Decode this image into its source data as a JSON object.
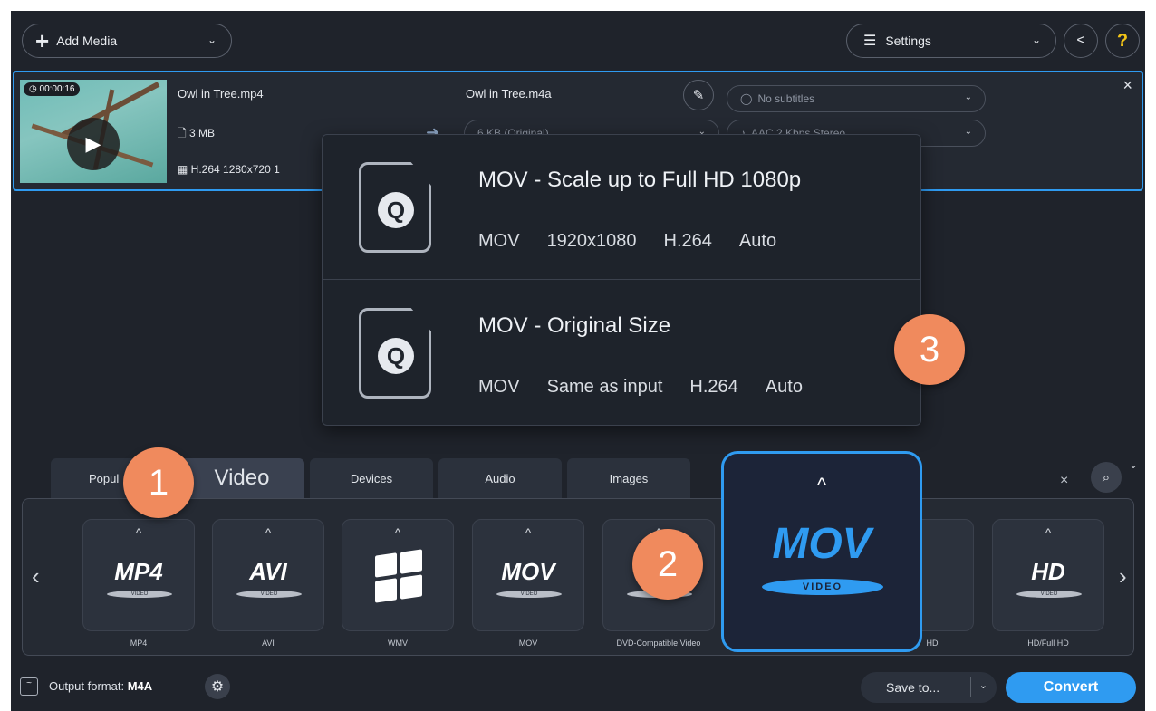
{
  "toolbar": {
    "add_media_label": "Add Media",
    "settings_label": "Settings",
    "help_label": "?"
  },
  "file": {
    "duration": "00:00:16",
    "input_name": "Owl in Tree.mp4",
    "input_size": "3 MB",
    "input_codec": "H.264 1280x720 1",
    "output_name": "Owl in Tree.m4a",
    "output_size": "6 KB (Original)",
    "subtitles": "No subtitles",
    "audio": "AAC 2 Kbps Stereo"
  },
  "popup": {
    "presets": [
      {
        "title": "MOV - Scale up to Full HD 1080p",
        "meta": [
          "MOV",
          "1920x1080",
          "H.264",
          "Auto"
        ]
      },
      {
        "title": "MOV - Original Size",
        "meta": [
          "MOV",
          "Same as input",
          "H.264",
          "Auto"
        ]
      }
    ]
  },
  "badges": {
    "one": "1",
    "two": "2",
    "three": "3"
  },
  "tabs": {
    "popular": "Popul",
    "video": "Video",
    "devices": "Devices",
    "audio": "Audio",
    "images": "Images"
  },
  "formats": [
    {
      "logo": "MP4",
      "disc": "VIDEO",
      "label": "MP4"
    },
    {
      "logo": "AVI",
      "disc": "VIDEO",
      "label": "AVI"
    },
    {
      "logo": "",
      "disc": "",
      "label": "WMV"
    },
    {
      "logo": "MOV",
      "disc": "VIDEO",
      "label": "MOV"
    },
    {
      "logo": "D",
      "disc": "VIDEO",
      "label": "DVD-Compatible Video"
    },
    {
      "logo": "HD",
      "disc": "VIDEO",
      "label": "HD/Full HD"
    }
  ],
  "selected_format": {
    "logo": "MOV",
    "disc": "VIDEO"
  },
  "hidden_label_fragment": "HD",
  "footer": {
    "output_prefix": "Output format:",
    "output_value": "M4A",
    "save_label": "Save to...",
    "convert_label": "Convert"
  },
  "colors": {
    "accent": "#2f9bf1",
    "badge": "#f08a5d",
    "background": "#1f232b"
  }
}
